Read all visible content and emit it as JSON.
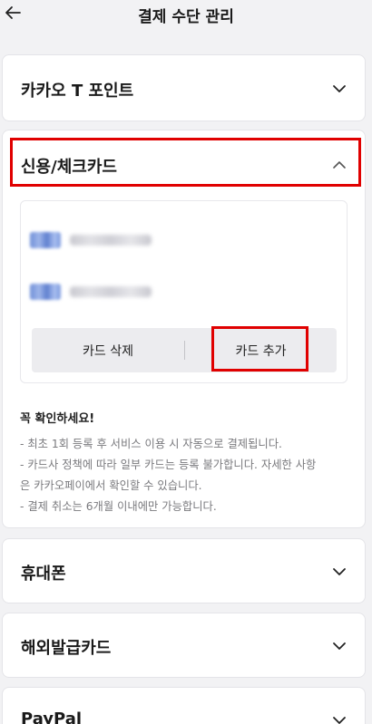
{
  "header": {
    "title": "결제 수단 관리"
  },
  "sections": {
    "kakao_t_point": {
      "title": "카카오 T 포인트"
    },
    "credit_check_card": {
      "title": "신용/체크카드",
      "buttons": {
        "delete_label": "카드 삭제",
        "add_label": "카드 추가"
      },
      "notice": {
        "title": "꼭 확인하세요!",
        "lines": [
          "- 최초 1회 등록 후 서비스 이용 시 자동으로 결제됩니다.",
          "- 카드사 정책에 따라 일부 카드는 등록 불가합니다. 자세한 사항",
          "은 카카오페이에서 확인할 수 있습니다.",
          "- 결제 취소는 6개월 이내에만 가능합니다."
        ]
      }
    },
    "mobile_phone": {
      "title": "휴대폰"
    },
    "overseas_card": {
      "title": "해외발급카드"
    },
    "paypal": {
      "title": "PayPal"
    }
  },
  "colors": {
    "highlight": "#e00000",
    "background": "#f2f2f4"
  },
  "icons": {
    "back": "arrow-left-icon",
    "collapsed": "chevron-down-icon",
    "expanded": "chevron-up-icon"
  }
}
